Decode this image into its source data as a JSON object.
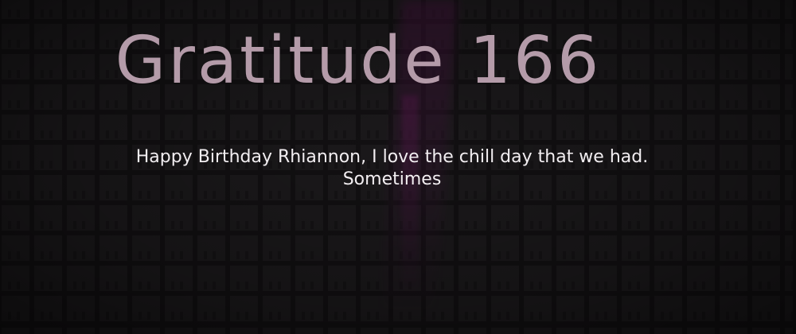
{
  "card": {
    "title": "Gratitude 166",
    "excerpt_line1": "Happy Birthday Rhiannon, I love the chill day that we had.",
    "excerpt_line2": "Sometimes"
  },
  "colors": {
    "background": "#1e1d1e",
    "title": "#b49ba9",
    "excerpt": "#f2eef1",
    "accent_glow": "#5a1450"
  }
}
